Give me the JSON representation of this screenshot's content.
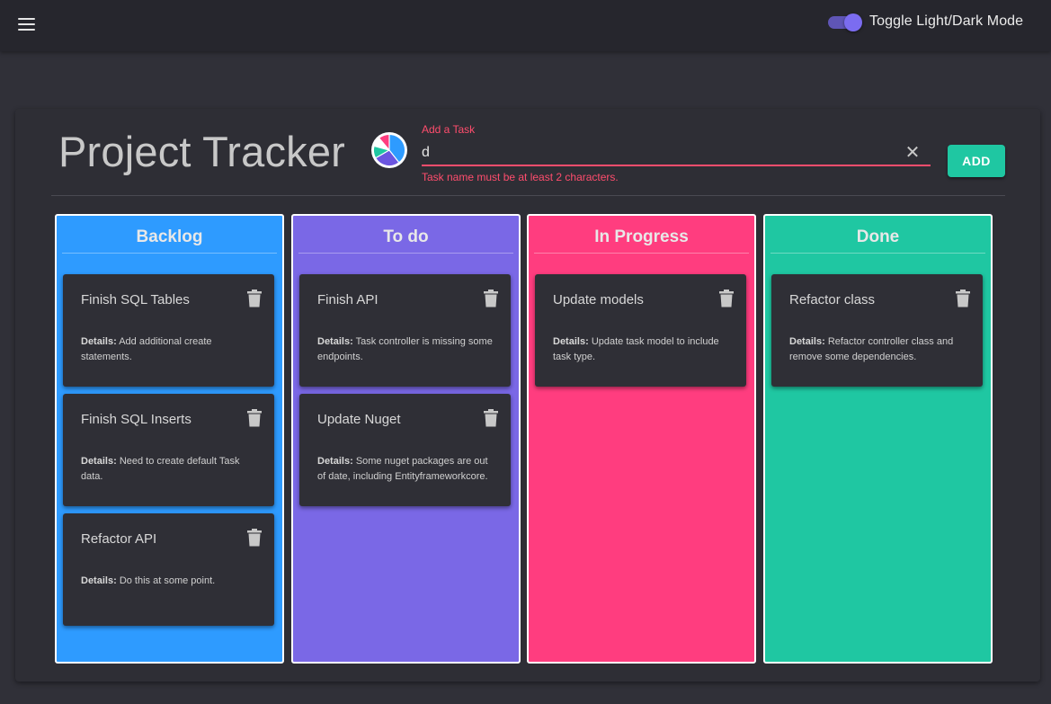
{
  "appbar": {
    "menu_icon": "hamburger-menu-icon",
    "toggle_label": "Toggle Light/Dark Mode",
    "toggle_on": true
  },
  "header": {
    "title": "Project Tracker",
    "logo_icon": "pie-chart-logo",
    "task_field": {
      "label": "Add a Task",
      "value": "d",
      "error": "Task name must be at least 2 characters."
    },
    "add_label": "ADD"
  },
  "details_prefix": "Details:",
  "columns": [
    {
      "name": "Backlog",
      "color": "#2e9bff",
      "cards": [
        {
          "title": "Finish SQL Tables",
          "details": "Add additional create statements."
        },
        {
          "title": "Finish SQL Inserts",
          "details": "Need to create default Task data."
        },
        {
          "title": "Refactor API",
          "details": "Do this at some point."
        }
      ]
    },
    {
      "name": "To do",
      "color": "#7a68e6",
      "cards": [
        {
          "title": "Finish API",
          "details": "Task controller is missing some endpoints."
        },
        {
          "title": "Update Nuget",
          "details": "Some nuget packages are out of date, including Entityframeworkcore."
        }
      ]
    },
    {
      "name": "In Progress",
      "color": "#ff3d7f",
      "cards": [
        {
          "title": "Update models",
          "details": "Update task model to include task type."
        }
      ]
    },
    {
      "name": "Done",
      "color": "#1fc7a2",
      "cards": [
        {
          "title": "Refactor class",
          "details": "Refactor controller class and remove some dependencies."
        }
      ]
    }
  ]
}
